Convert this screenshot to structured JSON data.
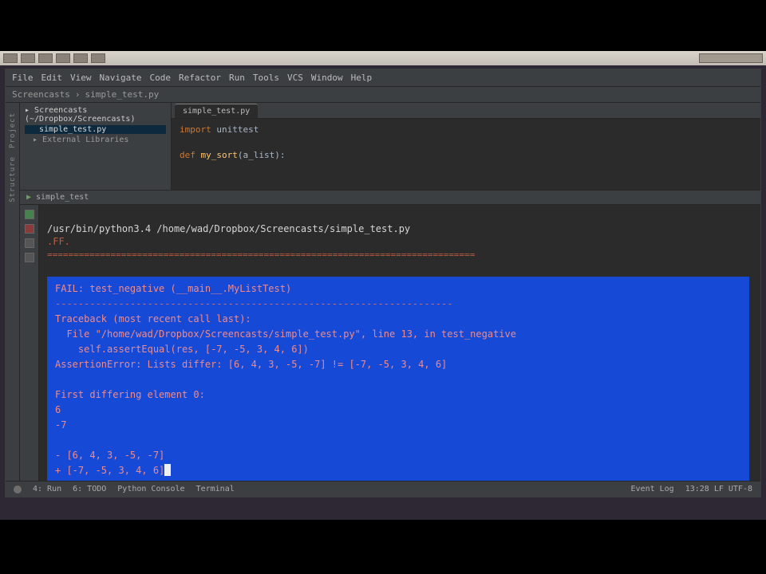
{
  "menubar": [
    "File",
    "Edit",
    "View",
    "Navigate",
    "Code",
    "Refactor",
    "Run",
    "Tools",
    "VCS",
    "Window",
    "Help"
  ],
  "breadcrumb": {
    "project": "Screencasts",
    "file": "simple_test.py"
  },
  "project": {
    "root": "Screencasts (~/Dropbox/Screencasts)",
    "file": "simple_test.py",
    "ext": "External Libraries"
  },
  "editor": {
    "tab": "simple_test.py",
    "line1_kw": "import",
    "line1_mod": "unittest",
    "line2_kw": "def",
    "line2_fn": "my_sort",
    "line2_arg": "(a_list):"
  },
  "run": {
    "title": "simple_test",
    "command": "/usr/bin/python3.4 /home/wad/Dropbox/Screencasts/simple_test.py",
    "result": ".FF.",
    "separator": "=================================================================================",
    "dash": "---------------------------------------------------------------------",
    "fail_header": "FAIL: test_negative (__main__.MyListTest)",
    "tb_intro": "Traceback (most recent call last):",
    "tb_file": "  File \"/home/wad/Dropbox/Screencasts/simple_test.py\", line 13, in test_negative",
    "tb_call": "    self.assertEqual(res, [-7, -5, 3, 4, 6])",
    "assert_err": "AssertionError: Lists differ: [6, 4, 3, -5, -7] != [-7, -5, 3, 4, 6]",
    "first_diff": "First differing element 0:",
    "diff_a": "6",
    "diff_b": "-7",
    "minus": "- [6, 4, 3, -5, -7]",
    "plus": "+ [-7, -5, 3, 4, 6]"
  },
  "status": {
    "left1": "4: Run",
    "left2": "6: TODO",
    "left3": "Python Console",
    "left4": "Terminal",
    "right1": "Event Log",
    "right2": "13:28  LF  UTF-8"
  }
}
